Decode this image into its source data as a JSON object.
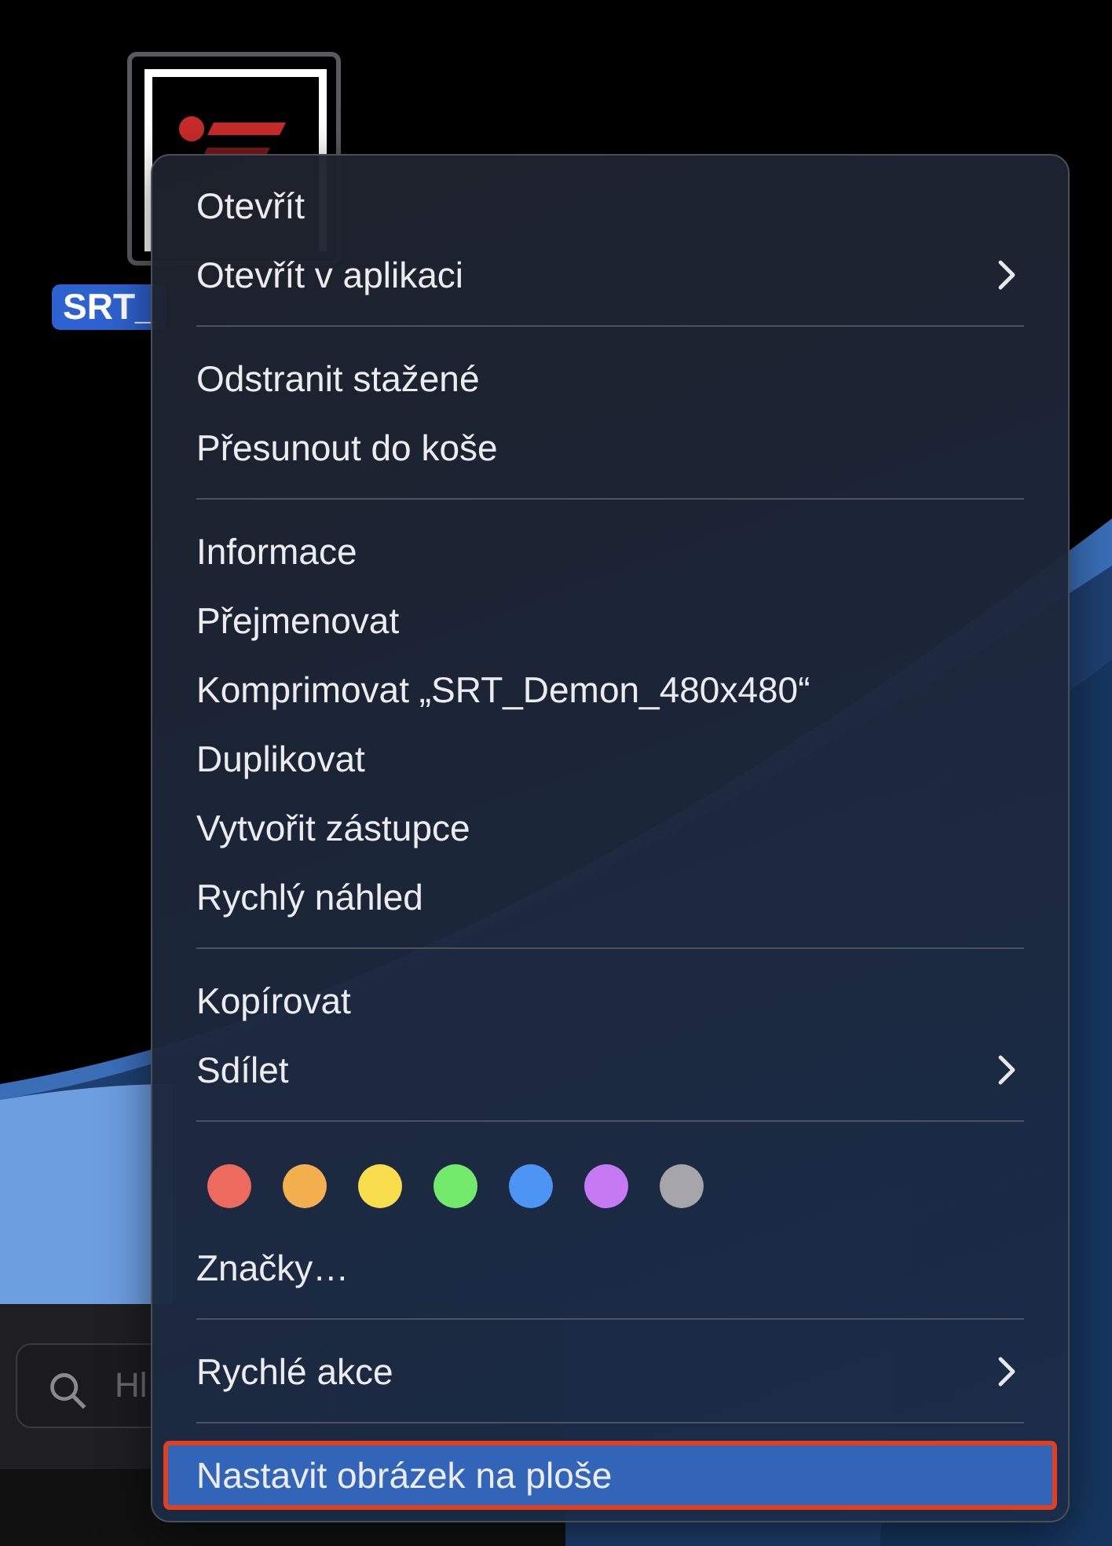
{
  "desktop": {
    "file": {
      "name": "SRT_",
      "selected": true
    },
    "search": {
      "placeholder": "Hl"
    }
  },
  "menu": {
    "sections": [
      {
        "items": [
          {
            "kind": "item",
            "label": "Otevřít",
            "selected": false
          },
          {
            "kind": "submenu",
            "label": "Otevřít v aplikaci",
            "selected": false
          }
        ]
      },
      {
        "items": [
          {
            "kind": "item",
            "label": "Odstranit stažené",
            "selected": false
          },
          {
            "kind": "item",
            "label": "Přesunout do koše",
            "selected": false
          }
        ]
      },
      {
        "items": [
          {
            "kind": "item",
            "label": "Informace",
            "selected": false
          },
          {
            "kind": "item",
            "label": "Přejmenovat",
            "selected": false
          },
          {
            "kind": "item",
            "label": "Komprimovat „SRT_Demon_480x480“",
            "selected": false
          },
          {
            "kind": "item",
            "label": "Duplikovat",
            "selected": false
          },
          {
            "kind": "item",
            "label": "Vytvořit zástupce",
            "selected": false
          },
          {
            "kind": "item",
            "label": "Rychlý náhled",
            "selected": false
          }
        ]
      },
      {
        "items": [
          {
            "kind": "item",
            "label": "Kopírovat",
            "selected": false
          },
          {
            "kind": "submenu",
            "label": "Sdílet",
            "selected": false
          }
        ]
      },
      {
        "items": [
          {
            "kind": "tags",
            "tags": [
              {
                "color": "#ec6a5e"
              },
              {
                "color": "#f4b04f"
              },
              {
                "color": "#f8dd4d"
              },
              {
                "color": "#73ea6c"
              },
              {
                "color": "#4d95f5"
              },
              {
                "color": "#c57af4"
              },
              {
                "color": "#a5a5aa"
              }
            ]
          },
          {
            "kind": "item",
            "label": "Značky…",
            "selected": false
          }
        ]
      },
      {
        "items": [
          {
            "kind": "submenu",
            "label": "Rychlé akce",
            "selected": false
          }
        ]
      },
      {
        "items": [
          {
            "kind": "item",
            "label": "Nastavit obrázek na ploše",
            "selected": true,
            "outlined": true
          }
        ]
      }
    ]
  }
}
